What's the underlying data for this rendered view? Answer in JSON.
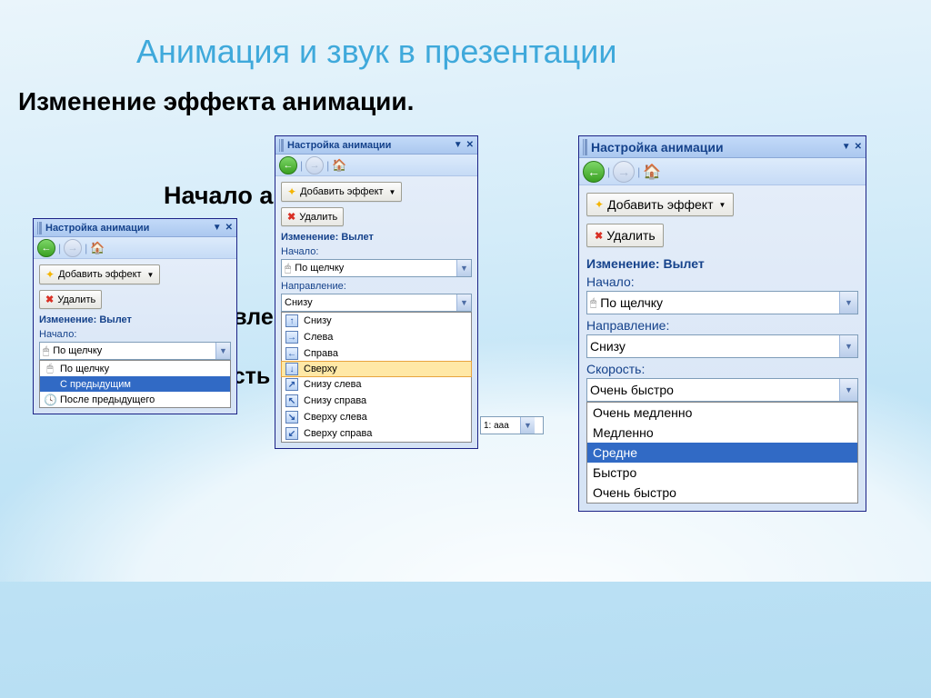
{
  "title": "Анимация и звук в презентации",
  "subtitle": "Изменение эффекта анимации.",
  "bullets": {
    "b1": "Начало анимации.",
    "b3": "Направление",
    "b4": "Скорость"
  },
  "pane": {
    "header": "Настройка анимации",
    "add_effect": "Добавить эффект",
    "remove": "Удалить",
    "modify_label": "Изменение: Вылет",
    "start_label": "Начало:",
    "start_value": "По щелчку",
    "direction_label": "Направление:",
    "direction_value": "Снизу",
    "speed_label": "Скорость:",
    "speed_value": "Очень быстро"
  },
  "start_options": [
    {
      "label": "По щелчку",
      "sel": false,
      "icon": "mouse"
    },
    {
      "label": "С предыдущим",
      "sel": true,
      "icon": ""
    },
    {
      "label": "После предыдущего",
      "sel": false,
      "icon": "clock"
    }
  ],
  "directions": [
    {
      "label": "Снизу",
      "arrow": "↑",
      "hover": false
    },
    {
      "label": "Слева",
      "arrow": "→",
      "hover": false
    },
    {
      "label": "Справа",
      "arrow": "←",
      "hover": false
    },
    {
      "label": "Сверху",
      "arrow": "↓",
      "hover": true
    },
    {
      "label": "Снизу слева",
      "arrow": "↗",
      "hover": false
    },
    {
      "label": "Снизу справа",
      "arrow": "↖",
      "hover": false
    },
    {
      "label": "Сверху слева",
      "arrow": "↘",
      "hover": false
    },
    {
      "label": "Сверху справа",
      "arrow": "↙",
      "hover": false
    }
  ],
  "speeds": [
    {
      "label": "Очень медленно",
      "sel": false
    },
    {
      "label": "Медленно",
      "sel": false
    },
    {
      "label": "Средне",
      "sel": true
    },
    {
      "label": "Быстро",
      "sel": false
    },
    {
      "label": "Очень быстро",
      "sel": false
    }
  ],
  "effect_item": "1: aaa"
}
